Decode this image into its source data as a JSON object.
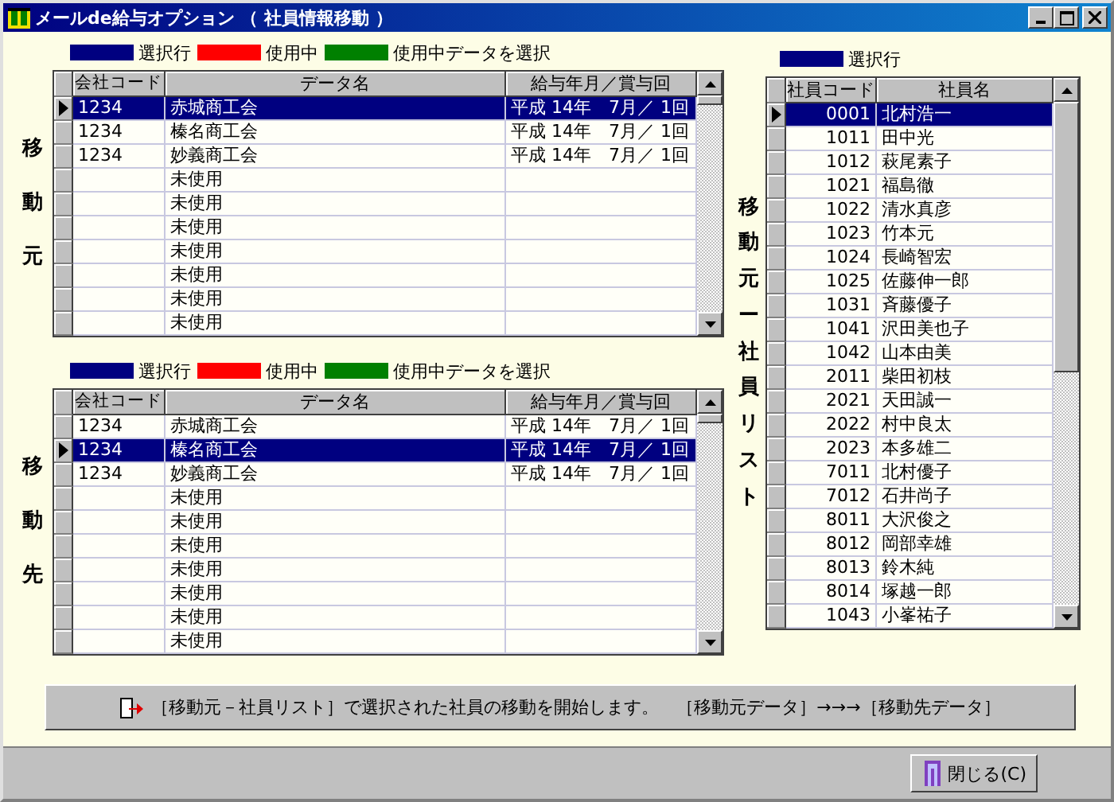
{
  "window": {
    "title": "メールde給与オプション （ 社員情報移動 ）"
  },
  "panels": [
    {
      "side_label": "移動元",
      "legend": [
        {
          "color": "#000080",
          "label": "選択行"
        },
        {
          "color": "#ff0000",
          "label": "使用中"
        },
        {
          "color": "#008000",
          "label": "使用中データを選択"
        }
      ],
      "table": {
        "columns": [
          "会社コード",
          "データ名",
          "給与年月／賞与回"
        ],
        "rows": [
          {
            "selected": true,
            "cells": [
              "1234",
              "赤城商工会",
              "平成 14年　7月／ 1回"
            ]
          },
          {
            "selected": false,
            "cells": [
              "1234",
              "榛名商工会",
              "平成 14年　7月／ 1回"
            ]
          },
          {
            "selected": false,
            "cells": [
              "1234",
              "妙義商工会",
              "平成 14年　7月／ 1回"
            ]
          },
          {
            "selected": false,
            "cells": [
              "",
              "未使用",
              ""
            ]
          },
          {
            "selected": false,
            "cells": [
              "",
              "未使用",
              ""
            ]
          },
          {
            "selected": false,
            "cells": [
              "",
              "未使用",
              ""
            ]
          },
          {
            "selected": false,
            "cells": [
              "",
              "未使用",
              ""
            ]
          },
          {
            "selected": false,
            "cells": [
              "",
              "未使用",
              ""
            ]
          },
          {
            "selected": false,
            "cells": [
              "",
              "未使用",
              ""
            ]
          },
          {
            "selected": false,
            "cells": [
              "",
              "未使用",
              ""
            ]
          }
        ]
      }
    },
    {
      "side_label": "移動先",
      "legend": [
        {
          "color": "#000080",
          "label": "選択行"
        },
        {
          "color": "#ff0000",
          "label": "使用中"
        },
        {
          "color": "#008000",
          "label": "使用中データを選択"
        }
      ],
      "table": {
        "columns": [
          "会社コード",
          "データ名",
          "給与年月／賞与回"
        ],
        "rows": [
          {
            "selected": false,
            "cells": [
              "1234",
              "赤城商工会",
              "平成 14年　7月／ 1回"
            ]
          },
          {
            "selected": true,
            "cells": [
              "1234",
              "榛名商工会",
              "平成 14年　7月／ 1回"
            ]
          },
          {
            "selected": false,
            "cells": [
              "1234",
              "妙義商工会",
              "平成 14年　7月／ 1回"
            ]
          },
          {
            "selected": false,
            "cells": [
              "",
              "未使用",
              ""
            ]
          },
          {
            "selected": false,
            "cells": [
              "",
              "未使用",
              ""
            ]
          },
          {
            "selected": false,
            "cells": [
              "",
              "未使用",
              ""
            ]
          },
          {
            "selected": false,
            "cells": [
              "",
              "未使用",
              ""
            ]
          },
          {
            "selected": false,
            "cells": [
              "",
              "未使用",
              ""
            ]
          },
          {
            "selected": false,
            "cells": [
              "",
              "未使用",
              ""
            ]
          },
          {
            "selected": false,
            "cells": [
              "",
              "未使用",
              ""
            ]
          }
        ]
      }
    }
  ],
  "employee_panel": {
    "side_label": "移動元ー社員リスト",
    "legend": [
      {
        "color": "#000080",
        "label": "選択行"
      }
    ],
    "table": {
      "columns": [
        "社員コード",
        "社員名"
      ],
      "rows": [
        {
          "selected": true,
          "cells": [
            "0001",
            "北村浩一"
          ]
        },
        {
          "selected": false,
          "cells": [
            "1011",
            "田中光"
          ]
        },
        {
          "selected": false,
          "cells": [
            "1012",
            "萩尾素子"
          ]
        },
        {
          "selected": false,
          "cells": [
            "1021",
            "福島徹"
          ]
        },
        {
          "selected": false,
          "cells": [
            "1022",
            "清水真彦"
          ]
        },
        {
          "selected": false,
          "cells": [
            "1023",
            "竹本元"
          ]
        },
        {
          "selected": false,
          "cells": [
            "1024",
            "長崎智宏"
          ]
        },
        {
          "selected": false,
          "cells": [
            "1025",
            "佐藤伸一郎"
          ]
        },
        {
          "selected": false,
          "cells": [
            "1031",
            "斉藤優子"
          ]
        },
        {
          "selected": false,
          "cells": [
            "1041",
            "沢田美也子"
          ]
        },
        {
          "selected": false,
          "cells": [
            "1042",
            "山本由美"
          ]
        },
        {
          "selected": false,
          "cells": [
            "2011",
            "柴田初枝"
          ]
        },
        {
          "selected": false,
          "cells": [
            "2021",
            "天田誠一"
          ]
        },
        {
          "selected": false,
          "cells": [
            "2022",
            "村中良太"
          ]
        },
        {
          "selected": false,
          "cells": [
            "2023",
            "本多雄二"
          ]
        },
        {
          "selected": false,
          "cells": [
            "7011",
            "北村優子"
          ]
        },
        {
          "selected": false,
          "cells": [
            "7012",
            "石井尚子"
          ]
        },
        {
          "selected": false,
          "cells": [
            "8011",
            "大沢俊之"
          ]
        },
        {
          "selected": false,
          "cells": [
            "8012",
            "岡部幸雄"
          ]
        },
        {
          "selected": false,
          "cells": [
            "8013",
            "鈴木純"
          ]
        },
        {
          "selected": false,
          "cells": [
            "8014",
            "塚越一郎"
          ]
        },
        {
          "selected": false,
          "cells": [
            "1043",
            "小峯祐子"
          ]
        }
      ]
    }
  },
  "start_button": {
    "label": "［移動元－社員リスト］で選択された社員の移動を開始します。　［移動元データ］→→→［移動先データ］"
  },
  "close_button": {
    "label": "閉じる(C)"
  }
}
